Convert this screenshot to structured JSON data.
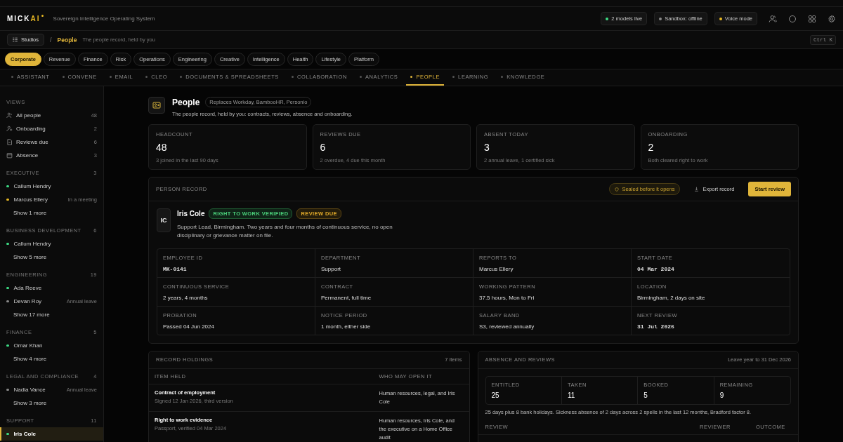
{
  "app": {
    "logo": "MICK**AI**",
    "tagline": "Sovereign Intelligence Operating System",
    "status_pills": [
      {
        "label": "2 models live",
        "color": "#3ddc84"
      },
      {
        "label": "Sandbox: offline",
        "color": "#8a8a8a"
      },
      {
        "label": "Voice mode",
        "color": "#e8b923"
      }
    ]
  },
  "breadcrumb": {
    "studios": "Studios",
    "separator": "/",
    "current": "People",
    "description": "The people record, held by you",
    "shortcut": "Ctrl K"
  },
  "studio_chips": [
    {
      "label": "Corporate",
      "selected": true
    },
    {
      "label": "Revenue",
      "selected": false
    },
    {
      "label": "Finance",
      "selected": false
    },
    {
      "label": "Risk",
      "selected": false
    },
    {
      "label": "Operations",
      "selected": false
    },
    {
      "label": "Engineering",
      "selected": false
    },
    {
      "label": "Creative",
      "selected": false
    },
    {
      "label": "Intelligence",
      "selected": false
    },
    {
      "label": "Health",
      "selected": false
    },
    {
      "label": "Lifestyle",
      "selected": false
    },
    {
      "label": "Platform",
      "selected": false
    }
  ],
  "tabs": [
    {
      "label": "ASSISTANT",
      "selected": false
    },
    {
      "label": "CONVENE",
      "selected": false
    },
    {
      "label": "EMAIL",
      "selected": false
    },
    {
      "label": "CLEO",
      "selected": false
    },
    {
      "label": "DOCUMENTS & SPREADSHEETS",
      "selected": false
    },
    {
      "label": "COLLABORATION",
      "selected": false
    },
    {
      "label": "ANALYTICS",
      "selected": false
    },
    {
      "label": "PEOPLE",
      "selected": true
    },
    {
      "label": "LEARNING",
      "selected": false
    },
    {
      "label": "KNOWLEDGE",
      "selected": false
    }
  ],
  "sidebar": {
    "views_title": "VIEWS",
    "views": [
      {
        "kind": "people",
        "label": "All people",
        "count": "48"
      },
      {
        "kind": "add-person",
        "label": "Onboarding",
        "count": "2"
      },
      {
        "kind": "document",
        "label": "Reviews due",
        "count": "6"
      },
      {
        "kind": "calendar",
        "label": "Absence",
        "count": "3"
      }
    ],
    "groups": [
      {
        "title": "EXECUTIVE",
        "count": "3",
        "people": [
          {
            "name": "Callum Hendry",
            "color": "#3ddc84",
            "selected": false
          },
          {
            "name": "Marcus Ellery",
            "color": "#e8b923",
            "note": "In a meeting",
            "selected": false
          }
        ],
        "more": "Show 1 more"
      },
      {
        "title": "BUSINESS DEVELOPMENT",
        "count": "6",
        "people": [
          {
            "name": "Callum Hendry",
            "color": "#3ddc84",
            "selected": false
          }
        ],
        "more": "Show 5 more"
      },
      {
        "title": "ENGINEERING",
        "count": "19",
        "people": [
          {
            "name": "Ada Reeve",
            "color": "#3ddc84",
            "selected": false
          },
          {
            "name": "Devan Roy",
            "color": "#8a8a8a",
            "note": "Annual leave",
            "selected": false
          }
        ],
        "more": "Show 17 more"
      },
      {
        "title": "FINANCE",
        "count": "5",
        "people": [
          {
            "name": "Omar Khan",
            "color": "#3ddc84",
            "selected": false
          }
        ],
        "more": "Show 4 more"
      },
      {
        "title": "LEGAL AND COMPLIANCE",
        "count": "4",
        "people": [
          {
            "name": "Nadia Vance",
            "color": "#8a8a8a",
            "note": "Annual leave",
            "selected": false
          }
        ],
        "more": "Show 3 more"
      },
      {
        "title": "SUPPORT",
        "count": "11",
        "people": [
          {
            "name": "Iris Cole",
            "color": "#3ddc84",
            "selected": true
          }
        ]
      }
    ]
  },
  "page": {
    "title": "People",
    "badge": "Replaces Workday, BambooHR, Personio",
    "subtitle": "The people record, held by you: contracts, reviews, absence and onboarding."
  },
  "stats": [
    {
      "label": "HEADCOUNT",
      "value": "48",
      "note": "3 joined in the last 90 days"
    },
    {
      "label": "REVIEWS DUE",
      "value": "6",
      "note": "2 overdue, 4 due this month"
    },
    {
      "label": "ABSENT TODAY",
      "value": "3",
      "note": "2 annual leave, 1 certified sick"
    },
    {
      "label": "ONBOARDING",
      "value": "2",
      "note": "Both cleared right to work"
    }
  ],
  "person_record": {
    "title": "PERSON RECORD",
    "sealed": "Sealed before it opens",
    "export": "Export record",
    "start": "Start review",
    "initials": "IC",
    "name": "Iris Cole",
    "tags": [
      {
        "label": "RIGHT TO WORK VERIFIED",
        "kind": "good"
      },
      {
        "label": "REVIEW DUE",
        "kind": "warn"
      }
    ],
    "summary": "Support Lead, Birmingham. Two years and four months of continuous service, no open disciplinary or grievance matter on file.",
    "fields": [
      {
        "label": "EMPLOYEE ID",
        "value": "MK-0141",
        "kind": "mono"
      },
      {
        "label": "DEPARTMENT",
        "value": "Support",
        "kind": "text"
      },
      {
        "label": "REPORTS TO",
        "value": "Marcus Ellery",
        "kind": "text"
      },
      {
        "label": "START DATE",
        "value": "04 Mar 2024",
        "kind": "mono"
      },
      {
        "label": "CONTINUOUS SERVICE",
        "value": "2 years, 4 months",
        "kind": "text"
      },
      {
        "label": "CONTRACT",
        "value": "Permanent, full time",
        "kind": "text"
      },
      {
        "label": "WORKING PATTERN",
        "value": "37.5 hours, Mon to Fri",
        "kind": "text"
      },
      {
        "label": "LOCATION",
        "value": "Birmingham, 2 days on site",
        "kind": "text"
      },
      {
        "label": "PROBATION",
        "value": "Passed 04 Jun 2024",
        "kind": "text"
      },
      {
        "label": "NOTICE PERIOD",
        "value": "1 month, either side",
        "kind": "text"
      },
      {
        "label": "SALARY BAND",
        "value": "S3, reviewed annually",
        "kind": "text"
      },
      {
        "label": "NEXT REVIEW",
        "value": "31 Jul 2026",
        "kind": "mono"
      }
    ]
  },
  "record_holdings": {
    "title": "RECORD HOLDINGS",
    "count": "7 items",
    "columns": [
      "ITEM HELD",
      "WHO MAY OPEN IT"
    ],
    "rows": [
      {
        "item": "Contract of employment",
        "detail": "Signed 12 Jan 2026, third version",
        "who": "Human resources, legal, and Iris Cole"
      },
      {
        "item": "Right to work evidence",
        "detail": "Passport, verified 04 Mar 2024",
        "who": "Human resources, Iris Cole, and the executive on a Home Office audit"
      }
    ]
  },
  "absence": {
    "title": "ABSENCE AND REVIEWS",
    "period": "Leave year to 31 Dec 2026",
    "stats": [
      {
        "label": "ENTITLED",
        "value": "25"
      },
      {
        "label": "TAKEN",
        "value": "11"
      },
      {
        "label": "BOOKED",
        "value": "5"
      },
      {
        "label": "REMAINING",
        "value": "9"
      }
    ],
    "note": "25 days plus 8 bank holidays. Sickness absence of 2 days across 2 spells in the last 12 months, Bradford factor 8.",
    "columns": [
      "REVIEW",
      "REVIEWER",
      "OUTCOME"
    ]
  }
}
